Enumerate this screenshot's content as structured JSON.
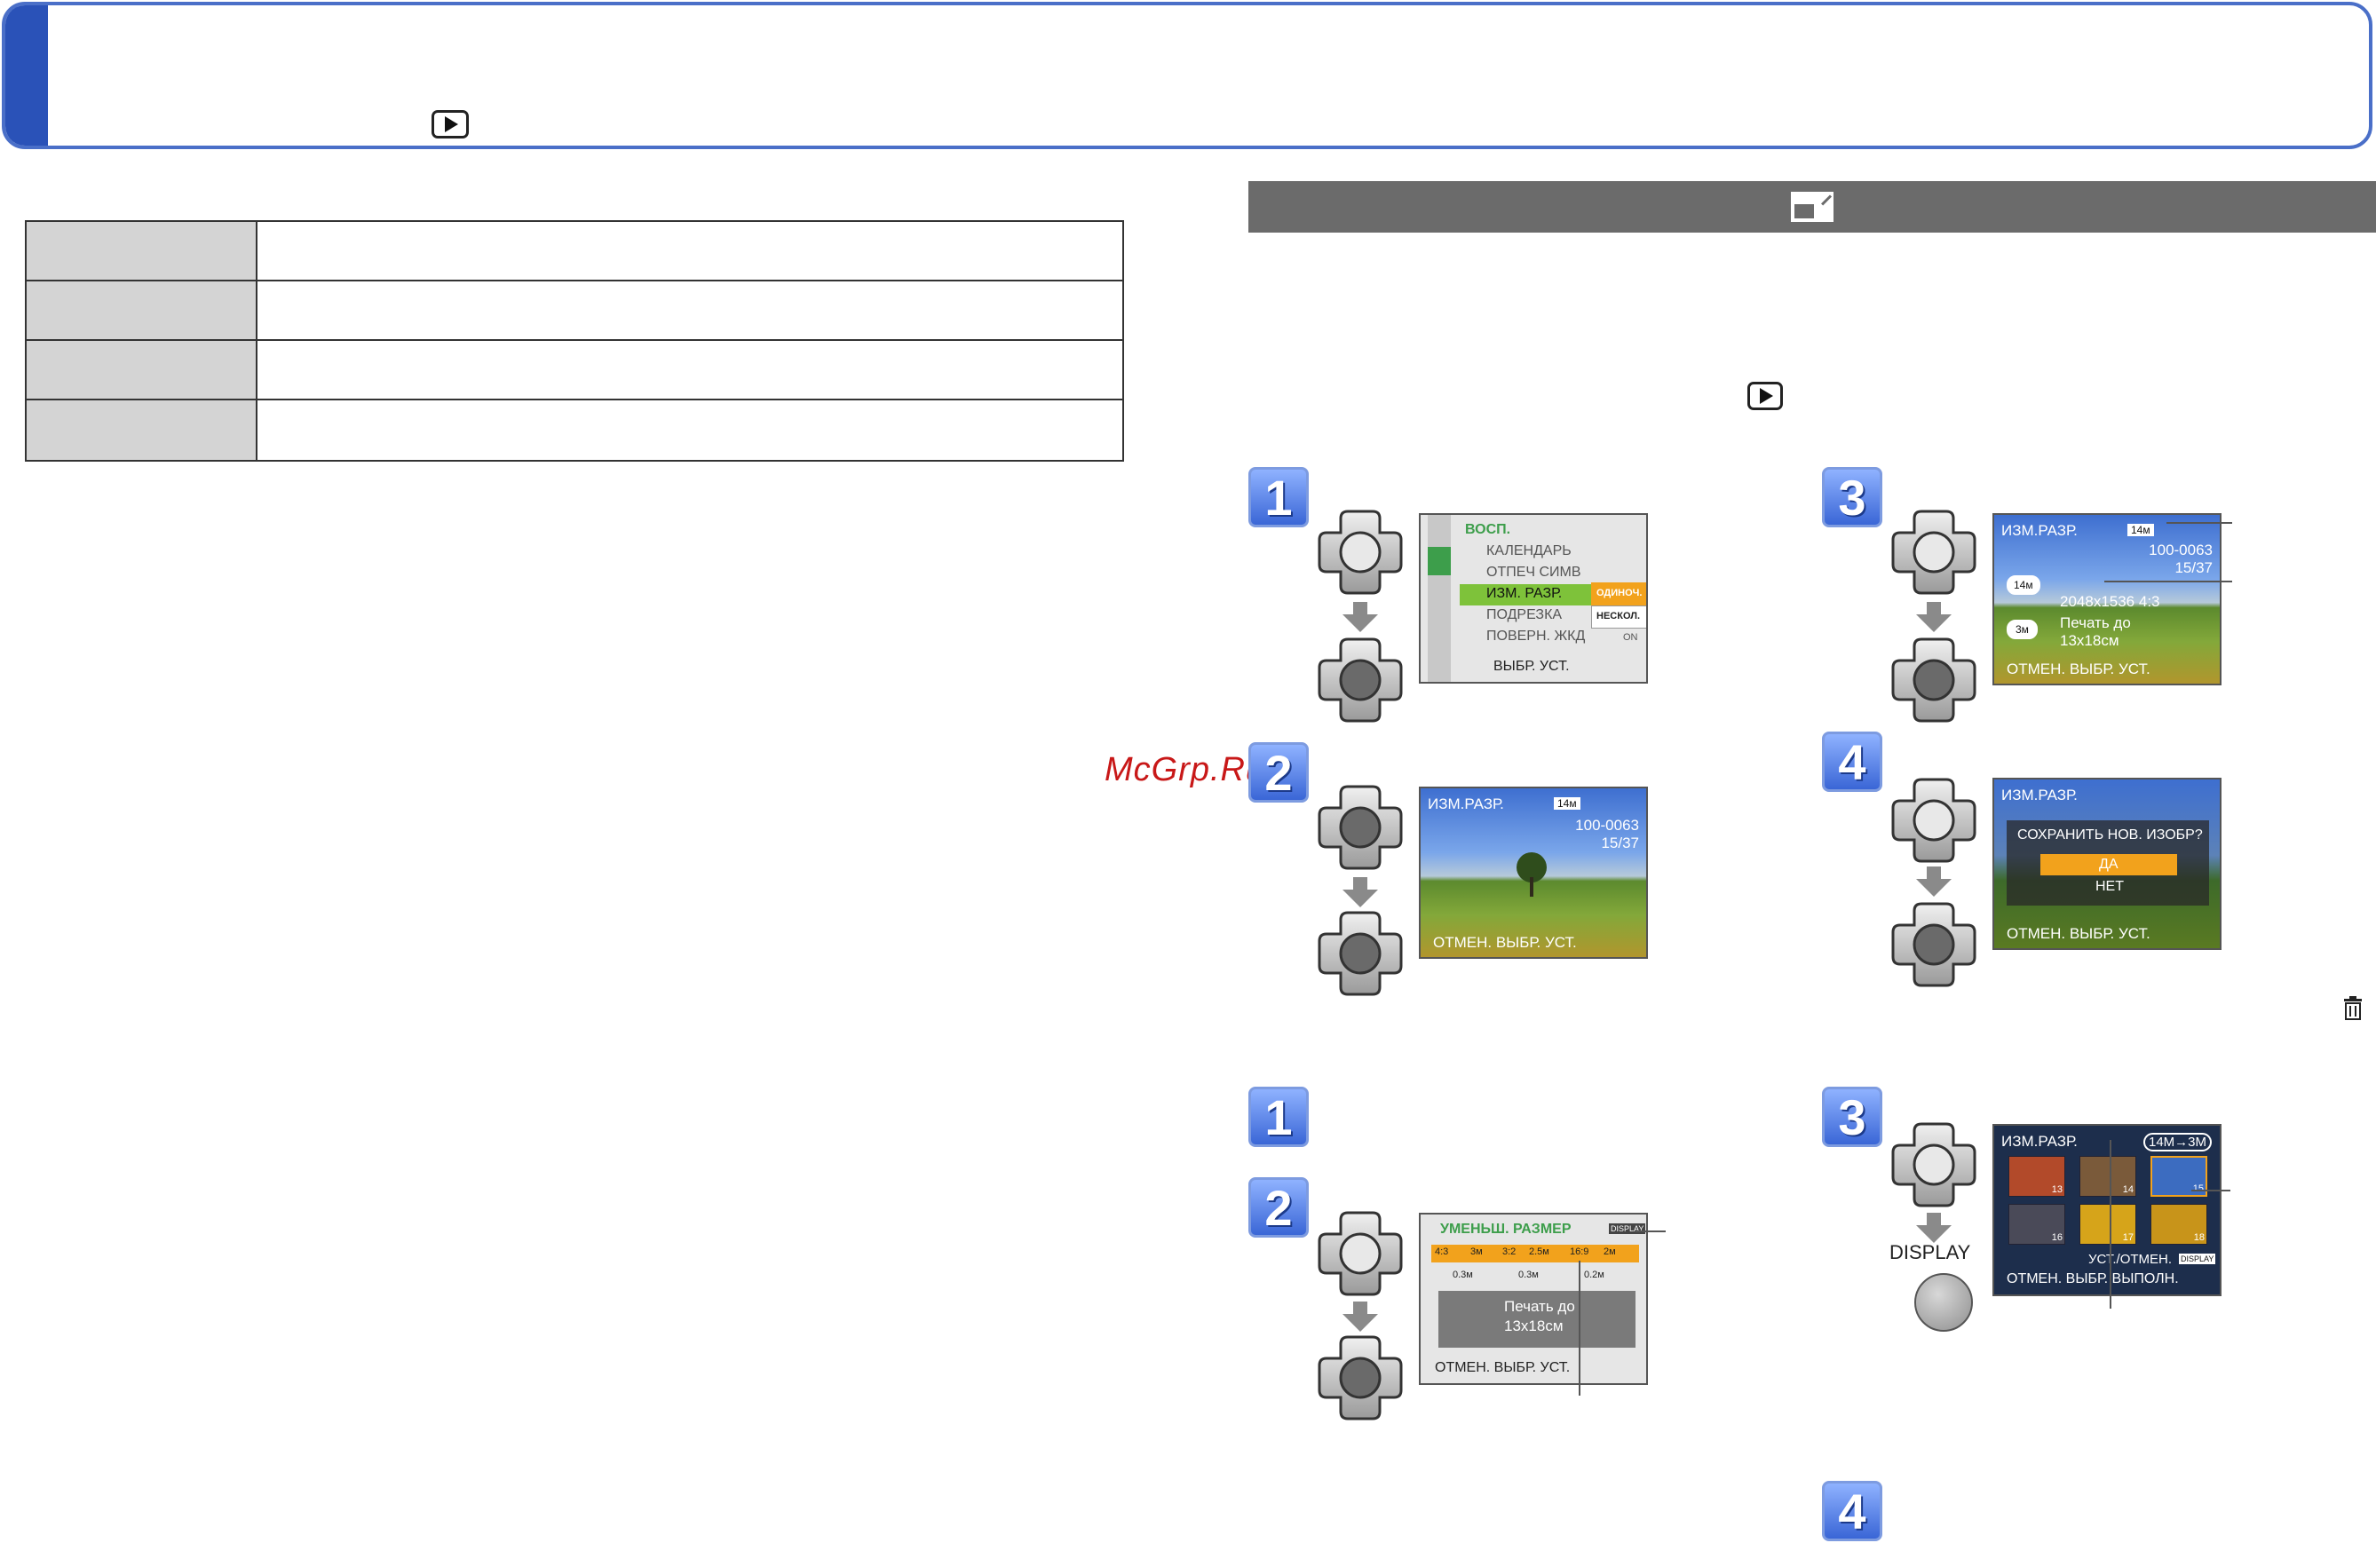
{
  "header": {
    "mode_icon": "play-icon"
  },
  "section": {
    "icon": "resize-icon",
    "mode_icon": "play-icon"
  },
  "watermark": "McGrp.Ru",
  "steps": {
    "upper": [
      "1",
      "2",
      "3",
      "4"
    ],
    "lower": [
      "1",
      "2",
      "3",
      "4"
    ]
  },
  "screen_menu": {
    "title": "ВОСП.",
    "items": [
      "КАЛЕНДАРЬ",
      "ОТПЕЧ СИМВ",
      "ИЗМ. РАЗР.",
      "ПОДРЕЗКА",
      "ПОВЕРН. ЖКД"
    ],
    "sub_options": [
      "ОДИНОЧ.",
      "НЕСКОЛ."
    ],
    "footer": "ВЫБР. УСТ.",
    "on_label": "ON"
  },
  "screen_photo": {
    "title": "ИЗМ.РАЗР.",
    "badge": "14м",
    "file_no": "100-0063",
    "counter": "15/37",
    "footer": "ОТМЕН. ВЫБР. УСТ."
  },
  "screen_resize_info": {
    "title": "ИЗМ.РАЗР.",
    "badge": "14м",
    "file_no": "100-0063",
    "counter": "15/37",
    "size_from": "14м",
    "size_to": "3м",
    "resolution": "2048x1536 4:3",
    "print_label": "Печать до",
    "print_size": "13x18см",
    "footer": "ОТМЕН. ВЫБР. УСТ."
  },
  "screen_confirm": {
    "title": "ИЗМ.РАЗР.",
    "question": "СОХРАНИТЬ НОВ. ИЗОБР?",
    "yes": "ДА",
    "no": "НЕТ",
    "footer": "ОТМЕН. ВЫБР. УСТ."
  },
  "screen_reduce": {
    "title": "УМЕНЬШ. РАЗМЕР",
    "display_badge": "DISPLAY",
    "ratios": [
      "4:3",
      "3м",
      "3:2",
      "2.5м",
      "16:9",
      "2м"
    ],
    "sizes": [
      "0.3м",
      "0.3м",
      "0.2м"
    ],
    "print_label": "Печать до",
    "print_size": "13x18см",
    "footer": "ОТМЕН. ВЫБР. УСТ."
  },
  "screen_multi": {
    "title": "ИЗМ.РАЗР.",
    "convert": "14M→3M",
    "thumbs": [
      "13",
      "14",
      "15",
      "16",
      "17",
      "18"
    ],
    "set_cancel": "УСТ./ОТМЕН.",
    "display_badge": "DISPLAY",
    "footer": "ОТМЕН. ВЫБР. ВЫПОЛН."
  },
  "display_button_label": "DISPLAY",
  "icons": {
    "trash": "trash-icon"
  }
}
